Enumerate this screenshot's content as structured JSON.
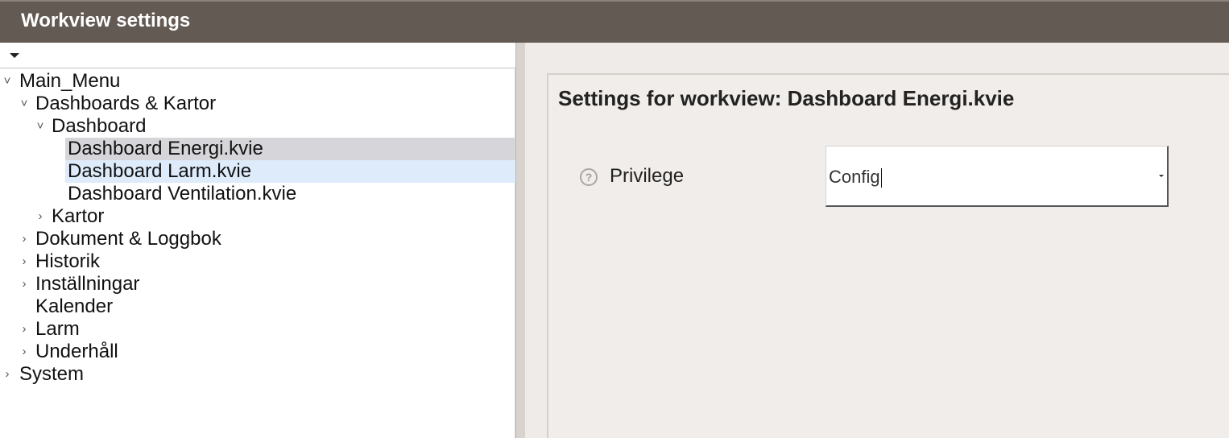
{
  "window": {
    "title": "Workview settings"
  },
  "tree": {
    "items": [
      {
        "label": "Main_Menu",
        "expanded": true
      },
      {
        "label": "Dashboards & Kartor",
        "expanded": true
      },
      {
        "label": "Dashboard",
        "expanded": true
      },
      {
        "label": "Dashboard Energi.kvie",
        "selected": true
      },
      {
        "label": "Dashboard Larm.kvie",
        "hover": true
      },
      {
        "label": "Dashboard Ventilation.kvie"
      },
      {
        "label": "Kartor",
        "expanded": false
      },
      {
        "label": "Dokument & Loggbok",
        "expanded": false
      },
      {
        "label": "Historik",
        "expanded": false
      },
      {
        "label": "Inställningar",
        "expanded": false
      },
      {
        "label": "Kalender"
      },
      {
        "label": "Larm",
        "expanded": false
      },
      {
        "label": "Underhåll",
        "expanded": false
      },
      {
        "label": "System",
        "expanded": false
      }
    ]
  },
  "settings": {
    "heading": "Settings for workview: Dashboard Energi.kvie",
    "privilege_label": "Privilege",
    "privilege_value": "Config"
  }
}
